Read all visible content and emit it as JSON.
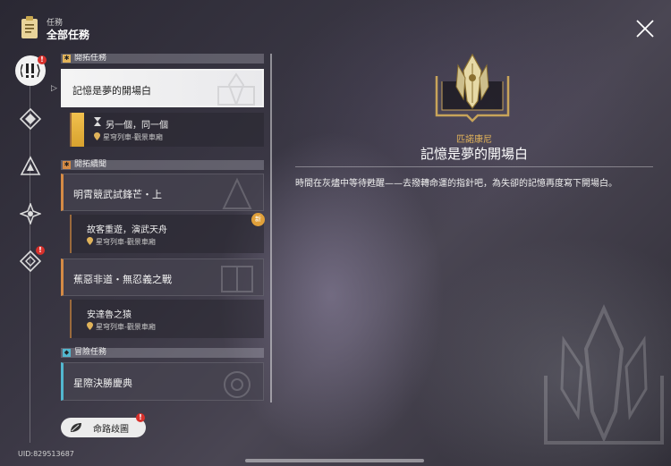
{
  "header": {
    "label": "任務",
    "title": "全部任務"
  },
  "close_icon": "close-icon",
  "rail": {
    "items": [
      {
        "icon": "all-missions-icon",
        "badge": "!"
      },
      {
        "icon": "trailblaze-icon"
      },
      {
        "icon": "companion-icon"
      },
      {
        "icon": "adventure-icon"
      },
      {
        "icon": "daily-icon",
        "badge": "!"
      }
    ]
  },
  "list": {
    "sections": [
      {
        "label": "開拓任務"
      },
      {
        "label": "開拓續聞"
      },
      {
        "label": "冒險任務"
      }
    ],
    "cards": [
      {
        "title": "記憶是夢的開場白"
      },
      {
        "title": "明霄競武試鋒芒・上"
      },
      {
        "title": "蕉惡非道・無忍義之戰"
      },
      {
        "title": "星際決勝慶典"
      }
    ],
    "subs": [
      {
        "title": "另一個，同一個",
        "location": "星穹列車-觀景車廂"
      },
      {
        "title": "故客重遊，演武天舟",
        "location": "星穹列車-觀景車廂"
      },
      {
        "title": "安達魯之猿",
        "location": "星穹列車-觀景車廂"
      }
    ],
    "new_badge": "新"
  },
  "fate_button": {
    "label": "命路歧圖",
    "badge": "!"
  },
  "uid": "UID:829513687",
  "detail": {
    "faction": "匹諾康尼",
    "title": "記憶是夢的開場白",
    "description": "時間在灰燼中等待甦醒——去撥轉命運的指針吧，為失卻的記憶再度寫下開場白。"
  },
  "colors": {
    "accent_gold": "#e3b45a",
    "trailblaze_orange": "#d58b45",
    "adventure_cyan": "#52b7cf",
    "badge_red": "#d8312c"
  }
}
